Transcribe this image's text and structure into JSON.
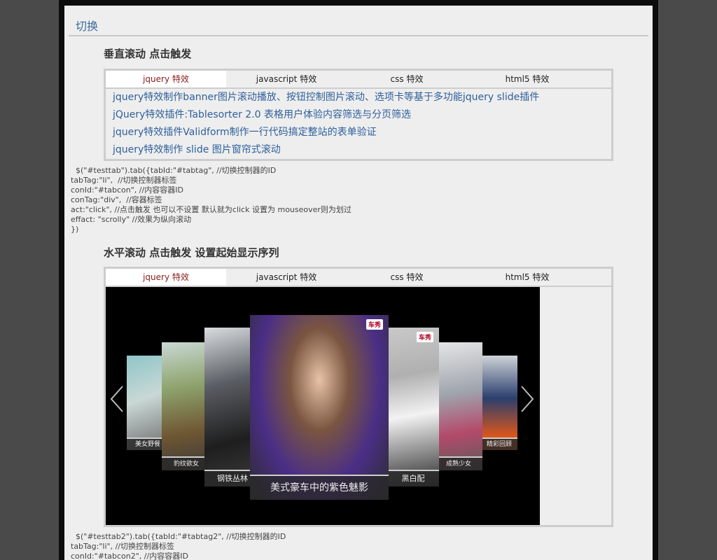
{
  "page": {
    "title": "切换"
  },
  "section1": {
    "heading": "垂直滚动 点击触发",
    "tabs": [
      "jquery 特效",
      "javascript 特效",
      "css 特效",
      "html5 特效"
    ],
    "links": [
      "jquery特效制作banner图片滚动播放、按钮控制图片滚动、选项卡等基于多功能jquery slide插件",
      "jQuery特效插件:Tablesorter 2.0 表格用户体验内容筛选与分页筛选",
      "jquery特效插件Validform制作一行代码搞定整站的表单验证",
      "jquery特效制作 slide 图片窗帘式滚动"
    ],
    "code": "  $(\"#testtab\").tab({tabId:\"#tabtag\", //切换控制器的ID\ntabTag:\"li\",  //切换控制器标签\nconId:\"#tabcon\", //内容容器ID\nconTag:\"div\",  //容器标签\nact:\"click\", //点击触发 也可以不设置 默认就为click 设置为 mouseover则为划过\neffact: \"scrolly\" //效果为纵向滚动\n})"
  },
  "section2": {
    "heading": "水平滚动 点击触发 设置起始显示序列",
    "tabs": [
      "jquery 特效",
      "javascript 特效",
      "css 特效",
      "html5 特效"
    ],
    "carousel": {
      "logo": "车秀",
      "captions": {
        "c1": "美女野餐",
        "c2": "豹纹欲女",
        "c3": "钢铁丛林",
        "center": "美式豪车中的紫色魅影",
        "c5": "黑白配",
        "c6": "成熟少女",
        "c7": "精彩回顾"
      },
      "prev_icon": "chevron-left-icon",
      "next_icon": "chevron-right-icon"
    },
    "code": "  $(\"#testtab2\").tab({tabId:\"#tabtag2\", //切换控制器的ID\ntabTag:\"li\", //切换控制器标签\nconId:\"#tabcon2\", //内容容器ID"
  }
}
